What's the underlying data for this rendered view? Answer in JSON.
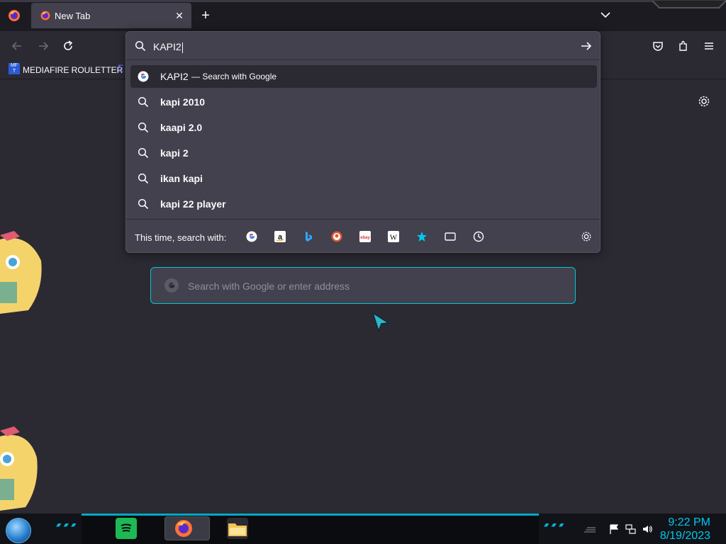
{
  "tab": {
    "title": "New Tab",
    "close": "✕"
  },
  "newtab": "+",
  "bookmarks": {
    "label": "MEDIAFIRE ROULETTER",
    "icon_text": "MF T"
  },
  "urlbar": {
    "value": "KAPI2",
    "suggestions": [
      {
        "text": "KAPI2",
        "sub": "— Search with Google",
        "icon": "google-icon",
        "selected": true
      },
      {
        "text": "kapi 2010",
        "icon": "search-icon"
      },
      {
        "text": "kaapi 2.0",
        "icon": "search-icon"
      },
      {
        "text": "kapi 2",
        "icon": "search-icon"
      },
      {
        "text": "ikan kapi",
        "icon": "search-icon"
      },
      {
        "text": "kapi 22 player",
        "icon": "search-icon"
      }
    ],
    "oneoff_label": "This time, search with:",
    "engines": [
      "google-icon",
      "amazon-icon",
      "bing-icon",
      "duckduckgo-icon",
      "ebay-icon",
      "wikipedia-icon",
      "bookmarks-icon",
      "tabs-icon",
      "history-icon"
    ]
  },
  "page": {
    "search_placeholder": "Search with Google or enter address"
  },
  "taskbar": {
    "time": "9:22 PM",
    "date": "8/19/2023"
  },
  "colors": {
    "accent": "#00c8d7",
    "clock": "#00c8f0",
    "bg": "#2b2a33",
    "panel": "#42414d"
  }
}
